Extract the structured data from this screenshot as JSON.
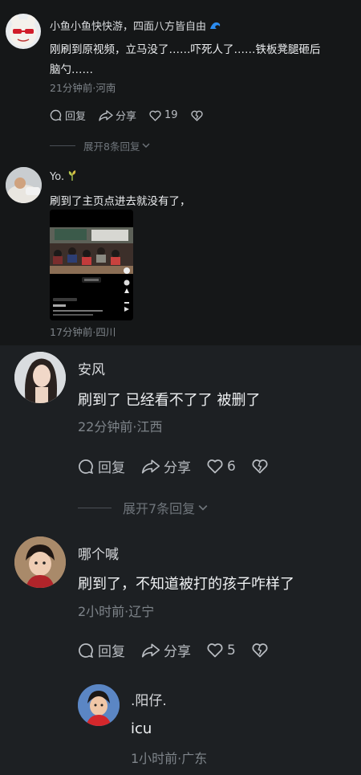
{
  "comments_top": [
    {
      "user": "小鱼小鱼快快游，四面八方皆自由",
      "text_line1": "刚刷到原视频，立马没了……吓死人了……铁板凳腿砸后",
      "text_line2": "脑勺……",
      "meta": "21分钟前·河南",
      "reply_label": "回复",
      "share_label": "分享",
      "like_count": "19",
      "expand_label": "展开8条回复"
    },
    {
      "user": "Yo.",
      "text": "刷到了主页点进去就没有了，",
      "meta": "17分钟前·四川",
      "thumb": {
        "overlay_lines": [
          "一个孩子被打，现在这…",
          "@视频"
        ]
      }
    }
  ],
  "comments_bottom": [
    {
      "user": "安风",
      "text": "刷到了 已经看不了了 被删了",
      "meta": "22分钟前·江西",
      "reply_label": "回复",
      "share_label": "分享",
      "like_count": "6",
      "expand_label": "展开7条回复"
    },
    {
      "user": "哪个喊",
      "text": "刷到了，不知道被打的孩子咋样了",
      "meta": "2小时前·辽宁",
      "reply_label": "回复",
      "share_label": "分享",
      "like_count": "5"
    },
    {
      "user": ".阳仔.",
      "text": "icu",
      "meta": "1小时前·广东"
    }
  ],
  "icons": {
    "reply": "comment-bubble-icon",
    "share": "share-arrow-icon",
    "like": "heart-icon",
    "dislike": "broken-heart-icon",
    "expand": "chevron-down-icon",
    "wave": "wave-emoji-icon",
    "sprout": "sprout-emoji-icon"
  },
  "colors": {
    "top_bg": "#151718",
    "bottom_bg": "#1d2023",
    "text": "#eef0f2",
    "meta": "#7e848a"
  }
}
